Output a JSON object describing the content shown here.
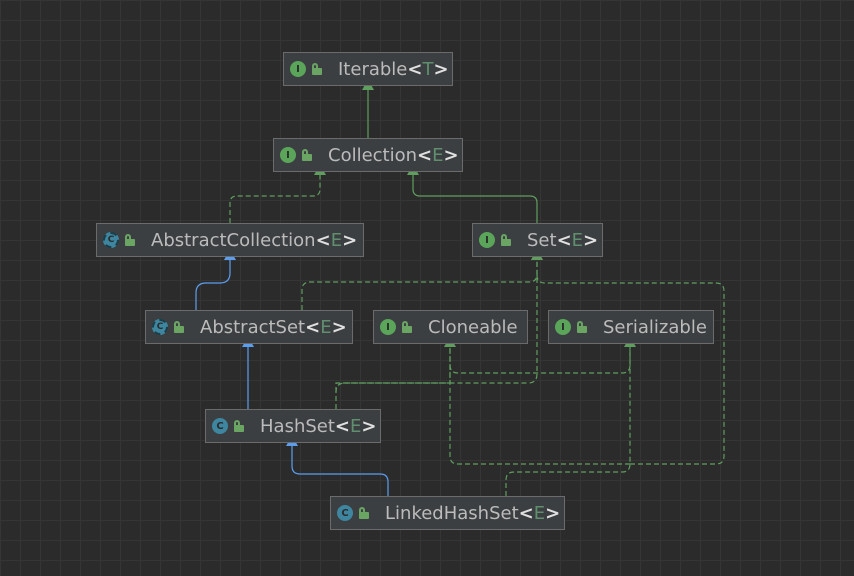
{
  "colors": {
    "background": "#2b2b2b",
    "node_fill": "#3c3f41",
    "node_border": "#6b6b6b",
    "text": "#bbbbbb",
    "type_param": "#5f8f6f",
    "implements_edge": "#5f9e5f",
    "extends_edge": "#5b9ef0",
    "interface_badge": "#5aa55a",
    "class_badge": "#3e86a0"
  },
  "nodes": {
    "iterable": {
      "name": "Iterable",
      "type_param": "T",
      "kind": "interface",
      "badge": "I"
    },
    "collection": {
      "name": "Collection",
      "type_param": "E",
      "kind": "interface",
      "badge": "I"
    },
    "abstract_collection": {
      "name": "AbstractCollection",
      "type_param": "E",
      "kind": "abstract-class",
      "badge": "C"
    },
    "set": {
      "name": "Set",
      "type_param": "E",
      "kind": "interface",
      "badge": "I"
    },
    "abstract_set": {
      "name": "AbstractSet",
      "type_param": "E",
      "kind": "abstract-class",
      "badge": "C"
    },
    "cloneable": {
      "name": "Cloneable",
      "type_param": "",
      "kind": "interface",
      "badge": "I"
    },
    "serializable": {
      "name": "Serializable",
      "type_param": "",
      "kind": "interface",
      "badge": "I"
    },
    "hash_set": {
      "name": "HashSet",
      "type_param": "E",
      "kind": "class",
      "badge": "C"
    },
    "linked_hash_set": {
      "name": "LinkedHashSet",
      "type_param": "E",
      "kind": "class",
      "badge": "C"
    }
  },
  "edges": [
    {
      "from": "collection",
      "to": "iterable",
      "kind": "extends-interface"
    },
    {
      "from": "set",
      "to": "collection",
      "kind": "extends-interface"
    },
    {
      "from": "abstract_collection",
      "to": "collection",
      "kind": "implements"
    },
    {
      "from": "abstract_set",
      "to": "abstract_collection",
      "kind": "extends"
    },
    {
      "from": "abstract_set",
      "to": "set",
      "kind": "implements"
    },
    {
      "from": "hash_set",
      "to": "abstract_set",
      "kind": "extends"
    },
    {
      "from": "hash_set",
      "to": "set",
      "kind": "implements"
    },
    {
      "from": "hash_set",
      "to": "cloneable",
      "kind": "implements"
    },
    {
      "from": "hash_set",
      "to": "serializable",
      "kind": "implements"
    },
    {
      "from": "linked_hash_set",
      "to": "hash_set",
      "kind": "extends"
    },
    {
      "from": "linked_hash_set",
      "to": "set",
      "kind": "implements"
    },
    {
      "from": "linked_hash_set",
      "to": "cloneable",
      "kind": "implements"
    },
    {
      "from": "linked_hash_set",
      "to": "serializable",
      "kind": "implements"
    }
  ]
}
